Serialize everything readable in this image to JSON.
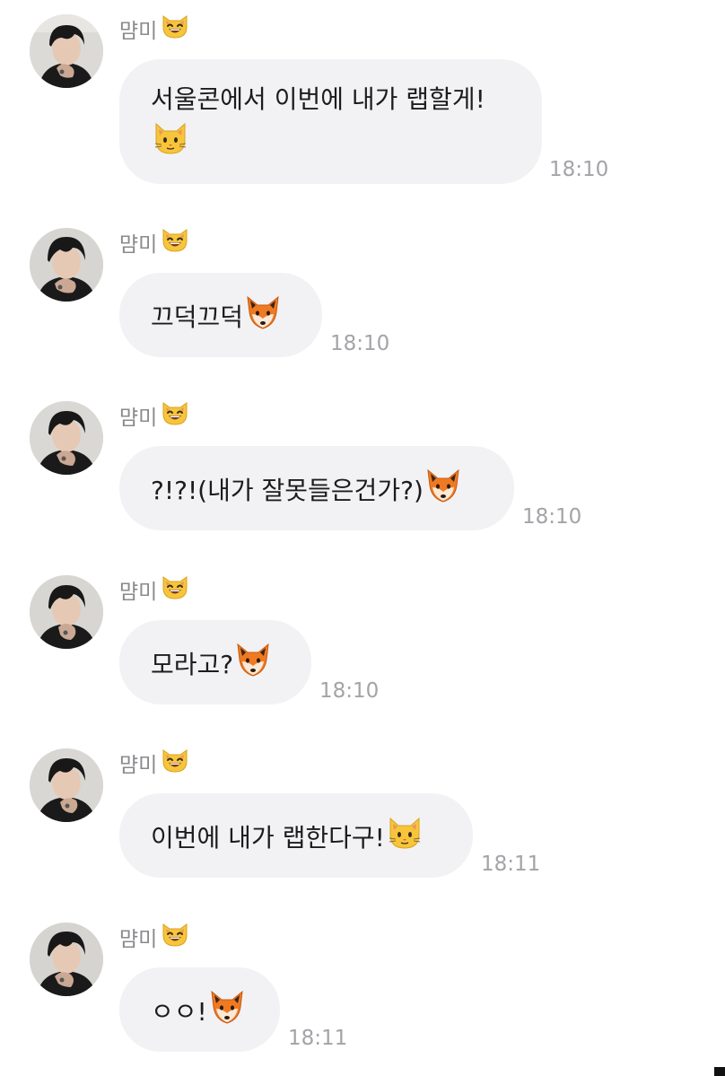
{
  "chat": {
    "messages": [
      {
        "sender": "먐미",
        "sender_emoji": "grinning-cat-icon",
        "text_lines": [
          "서울콘에서 이번에 내가 랩할게!",
          ""
        ],
        "emoji": "cat-face-icon",
        "time": "18:10"
      },
      {
        "sender": "먐미",
        "sender_emoji": "grinning-cat-icon",
        "text_lines": [
          "끄덕끄덕"
        ],
        "emoji": "fox-face-icon",
        "time": "18:10"
      },
      {
        "sender": "먐미",
        "sender_emoji": "grinning-cat-icon",
        "text_lines": [
          "?!?!(내가 잘못들은건가?)"
        ],
        "emoji": "fox-face-icon",
        "time": "18:10"
      },
      {
        "sender": "먐미",
        "sender_emoji": "grinning-cat-icon",
        "text_lines": [
          "모라고?"
        ],
        "emoji": "fox-face-icon",
        "time": "18:10"
      },
      {
        "sender": "먐미",
        "sender_emoji": "grinning-cat-icon",
        "text_lines": [
          "이번에 내가 랩한다구!"
        ],
        "emoji": "cat-face-icon",
        "time": "18:11"
      },
      {
        "sender": "먐미",
        "sender_emoji": "grinning-cat-icon",
        "text_lines": [
          "ㅇㅇ!"
        ],
        "emoji": "fox-face-icon",
        "time": "18:11"
      }
    ]
  }
}
